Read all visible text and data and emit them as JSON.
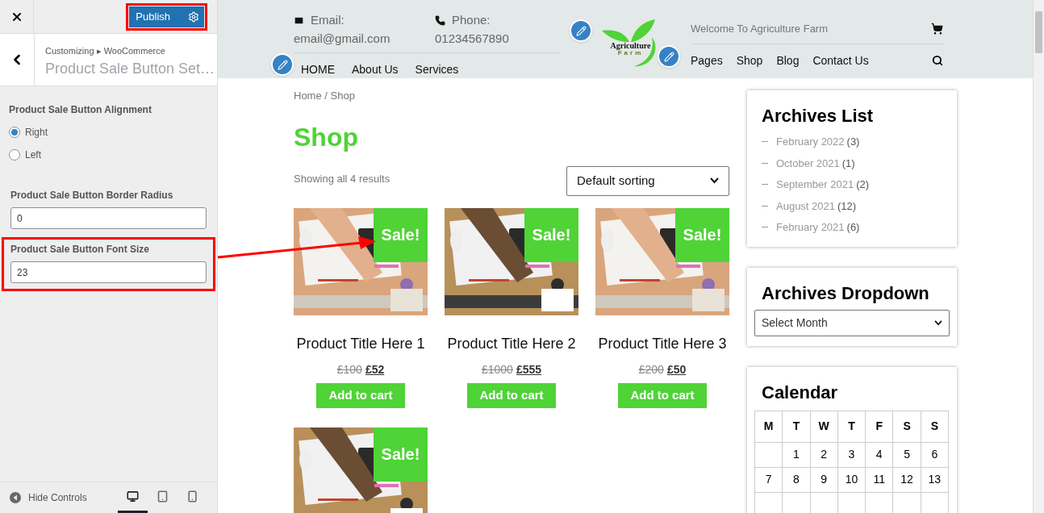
{
  "customizer": {
    "publish_label": "Publish",
    "breadcrumb": "Customizing ▸ WooCommerce",
    "section_title": "Product Sale Button Set…",
    "controls": [
      {
        "kind": "radio",
        "label": "Product Sale Button Alignment",
        "options": [
          {
            "label": "Right",
            "selected": true
          },
          {
            "label": "Left",
            "selected": false
          }
        ]
      },
      {
        "kind": "text",
        "label": "Product Sale Button Border Radius",
        "value": "0",
        "highlighted": false
      },
      {
        "kind": "text",
        "label": "Product Sale Button Font Size",
        "value": "23",
        "highlighted": true
      }
    ],
    "hide_controls": "Hide Controls",
    "devices": [
      {
        "kind": "desktop",
        "selected": true
      },
      {
        "kind": "tablet",
        "selected": false
      },
      {
        "kind": "mobile",
        "selected": false
      }
    ]
  },
  "header": {
    "email_label": "Email:",
    "email": "email@gmail.com",
    "phone_label": "Phone:",
    "phone": "01234567890",
    "logo_line1": "Agriculture",
    "logo_line2": "Farm",
    "welcome": "Welcome To Agriculture Farm",
    "nav_left": [
      "HOME",
      "About Us",
      "Services"
    ],
    "nav_right": [
      "Pages",
      "Shop",
      "Blog",
      "Contact Us"
    ]
  },
  "shop": {
    "breadcrumb": "Home / Shop",
    "title": "Shop",
    "result_count": "Showing all 4 results",
    "sorting": "Default sorting",
    "products": [
      {
        "sale_badge": "Sale!",
        "title": "Product Title Here 1",
        "old_price": "£100",
        "price": "£52",
        "button": "Add to cart",
        "kind": "picture"
      },
      {
        "sale_badge": "Sale!",
        "title": "Product Title Here 2",
        "old_price": "£1000",
        "price": "£555",
        "button": "Add to cart",
        "kind": "picture"
      },
      {
        "sale_badge": "Sale!",
        "title": "Product Title Here 3",
        "old_price": "£200",
        "price": "£50",
        "button": "Add to cart",
        "kind": "picture"
      },
      {
        "sale_badge": "Sale!",
        "kind": "picture"
      }
    ]
  },
  "sidebar": {
    "archives_title": "Archives List",
    "archives": [
      {
        "month": "February 2022",
        "count": "(3)"
      },
      {
        "month": "October 2021",
        "count": "(1)"
      },
      {
        "month": "September 2021",
        "count": "(2)"
      },
      {
        "month": "August 2021",
        "count": "(12)"
      },
      {
        "month": "February 2021",
        "count": "(6)"
      }
    ],
    "dropdown_title": "Archives Dropdown",
    "dropdown_value": "Select Month",
    "calendar_title": "Calendar",
    "weekdays": [
      "M",
      "T",
      "W",
      "T",
      "F",
      "S",
      "S"
    ],
    "weeks": [
      [
        "1",
        "2",
        "3",
        "4",
        "5",
        "6"
      ],
      [
        "7",
        "8",
        "9",
        "10",
        "11",
        "12",
        "13"
      ]
    ]
  }
}
